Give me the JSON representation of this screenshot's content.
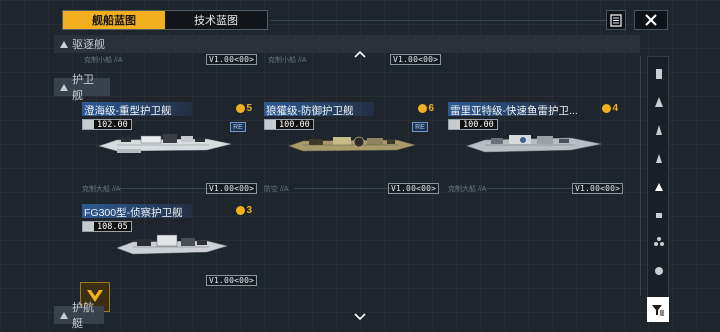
{
  "tabs": [
    {
      "label": "舰船蓝图",
      "active": true
    },
    {
      "label": "技术蓝图",
      "active": false
    }
  ],
  "header_icons": {
    "list": "list-icon",
    "close": "close-icon"
  },
  "sections": {
    "destroyer": {
      "label": "驱逐舰"
    },
    "frigate": {
      "label": "护卫舰"
    },
    "escort": {
      "label": "护航艇"
    }
  },
  "top_row": {
    "tag1": "克制小船 //A",
    "ver1": "V1.00<00>",
    "tag2": "克制小船 //A",
    "ver2": "V1.00<00>"
  },
  "cards": [
    {
      "title": "澄海级-重型护卫舰",
      "rank": "5",
      "stat": "102.00",
      "re": "RE",
      "foot_tag": "克制大船 //A",
      "ver": "V1.00<00>"
    },
    {
      "title": "狼獾级-防御护卫舰",
      "rank": "6",
      "stat": "100.00",
      "re": "RE",
      "foot_tag": "防空 //A",
      "ver": "V1.00<00>"
    },
    {
      "title": "雷里亚特级-快速鱼雷护卫...",
      "rank": "4",
      "stat": "100.00",
      "foot_tag": "克制大船 //A",
      "ver": "V1.00<00>"
    },
    {
      "title": "FG300型-侦察护卫舰",
      "rank": "3",
      "stat": "108.05",
      "ver": "V1.00<00>"
    }
  ],
  "colors": {
    "accent": "#f2b01e",
    "title_bg": "#2d5a96",
    "bg": "#1f252c"
  }
}
